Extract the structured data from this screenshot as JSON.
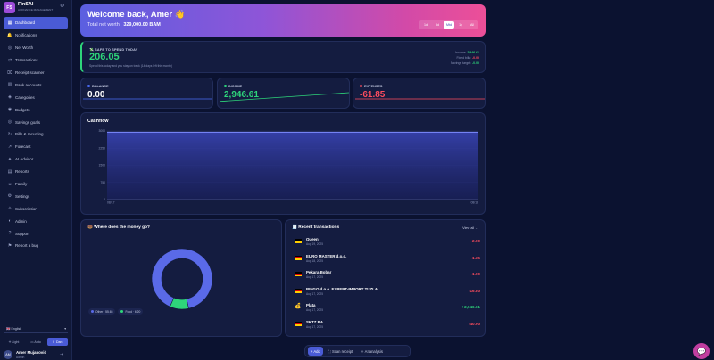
{
  "brand": {
    "logo": "FS",
    "name": "FinSAI",
    "subtitle": "AI FINANCE MANAGEMENT"
  },
  "nav": [
    {
      "label": "Dashboard",
      "icon": "▦",
      "active": true
    },
    {
      "label": "Notifications",
      "icon": "🔔"
    },
    {
      "label": "Net Worth",
      "icon": "◎"
    },
    {
      "label": "Transactions",
      "icon": "⇄"
    },
    {
      "label": "Receipt scanner",
      "icon": "⌧"
    },
    {
      "label": "Bank accounts",
      "icon": "▥"
    },
    {
      "label": "Categories",
      "icon": "◈"
    },
    {
      "label": "Budgets",
      "icon": "◉"
    },
    {
      "label": "Savings goals",
      "icon": "◎"
    },
    {
      "label": "Bills & recurring",
      "icon": "↻"
    },
    {
      "label": "Forecast",
      "icon": "↗"
    },
    {
      "label": "AI Advisor",
      "icon": "✦"
    },
    {
      "label": "Reports",
      "icon": "▤"
    },
    {
      "label": "Family",
      "icon": "☺"
    },
    {
      "label": "Settings",
      "icon": "⚙"
    },
    {
      "label": "Subscription",
      "icon": "✧"
    },
    {
      "label": "Admin",
      "icon": "◐"
    },
    {
      "label": "Support",
      "icon": "?"
    },
    {
      "label": "Report a bug",
      "icon": "⚑"
    }
  ],
  "language": {
    "label": "🇬🇧 English",
    "caret": "▾"
  },
  "theme": [
    {
      "label": "☀ Light"
    },
    {
      "label": "▭ Auto"
    },
    {
      "label": "☾ Dark",
      "active": true
    }
  ],
  "user": {
    "initials": "AM",
    "name": "Amer Mujanović",
    "role": "Admin"
  },
  "hero": {
    "greeting": "Welcome back, Amer 👋",
    "networth_label": "Total net worth",
    "networth_value": "329,000.00 BAM",
    "ranges": [
      {
        "label": "1d"
      },
      {
        "label": "5d"
      },
      {
        "label": "Mtd",
        "active": true
      },
      {
        "label": "1y"
      },
      {
        "label": "All"
      }
    ]
  },
  "safe_to_spend": {
    "label": "💸 SAFE TO SPEND TODAY",
    "value": "206.05",
    "note": "Spend this today and you stay on track (14 days left this month)",
    "breakdown": [
      {
        "label": "Income:",
        "value": "2,946.61",
        "tone": "pos"
      },
      {
        "label": "Fixed bills:",
        "value": "-0.00",
        "tone": "neg"
      },
      {
        "label": "Savings target:",
        "value": "-0.00",
        "tone": "pos"
      }
    ]
  },
  "stats": [
    {
      "label": "BALANCE",
      "value": "0.00",
      "color": "#ffffff",
      "dot": "#4a6cf7",
      "trend": [
        0.5,
        0.5
      ]
    },
    {
      "label": "INCOME",
      "value": "2,946.61",
      "color": "#2ed57a",
      "dot": "#2ed57a",
      "trend": [
        0.3,
        1.0
      ]
    },
    {
      "label": "EXPENSES",
      "value": "-61.85",
      "color": "#ff4d5e",
      "dot": "#ff4d5e",
      "trend": [
        0.5,
        0.5
      ]
    }
  ],
  "cashflow": {
    "title": "Cashflow",
    "chart_data": {
      "type": "area",
      "title": "Cashflow",
      "x": [
        "08/17",
        "08/18"
      ],
      "series": [
        {
          "values": [
            2946.61,
            2946.61
          ]
        }
      ],
      "yticks": [
        "0",
        "750",
        "1500",
        "2250",
        "3000"
      ],
      "ylim": [
        0,
        3000
      ],
      "grid": true
    }
  },
  "spending": {
    "title": "🍩 Where does the money go?",
    "chart_data": {
      "type": "pie",
      "slices": [
        {
          "name": "Other",
          "value": 55.65,
          "color": "#5a6ae8"
        },
        {
          "name": "Food",
          "value": 6.2,
          "color": "#2ed57a"
        }
      ]
    },
    "legend": [
      {
        "label": "Other · 55.65",
        "color": "#5a6ae8"
      },
      {
        "label": "Food · 6.20",
        "color": "#2ed57a"
      }
    ]
  },
  "transactions": {
    "title": "🧾 Recent transactions",
    "view_all": "View all →",
    "items": [
      {
        "name": "Queen",
        "date": "Aug 19, 2025",
        "amount": "-2.00",
        "tone": "neg",
        "icon": "flag"
      },
      {
        "name": "EURO MASTER d.o.o.",
        "date": "Aug 18, 2025",
        "amount": "-1.35",
        "tone": "neg",
        "icon": "flag"
      },
      {
        "name": "Pekara Bobar",
        "date": "Aug 17, 2025",
        "amount": "-1.00",
        "tone": "neg",
        "icon": "flag"
      },
      {
        "name": "BINGO d.o.o. EXPERT-IMPORT TUZLA",
        "date": "Aug 17, 2025",
        "amount": "-16.80",
        "tone": "neg",
        "icon": "flag"
      },
      {
        "name": "Plata",
        "date": "Aug 17, 2025",
        "amount": "+2,946.61",
        "tone": "pos",
        "icon": "money"
      },
      {
        "name": "SKTZ.BA",
        "date": "Aug 17, 2025",
        "amount": "-40.00",
        "tone": "neg",
        "icon": "flag"
      }
    ]
  },
  "quickbar": [
    {
      "label": "+ Add",
      "primary": true
    },
    {
      "label": "⛶ Scan receipt"
    },
    {
      "label": "✧ AI analysis"
    }
  ],
  "chat_icon": "💬",
  "colors": {
    "accent": "#4a5bd6",
    "income": "#2ed57a",
    "expense": "#ff4d5e",
    "background": "#0b1230",
    "card": "#141c40"
  }
}
